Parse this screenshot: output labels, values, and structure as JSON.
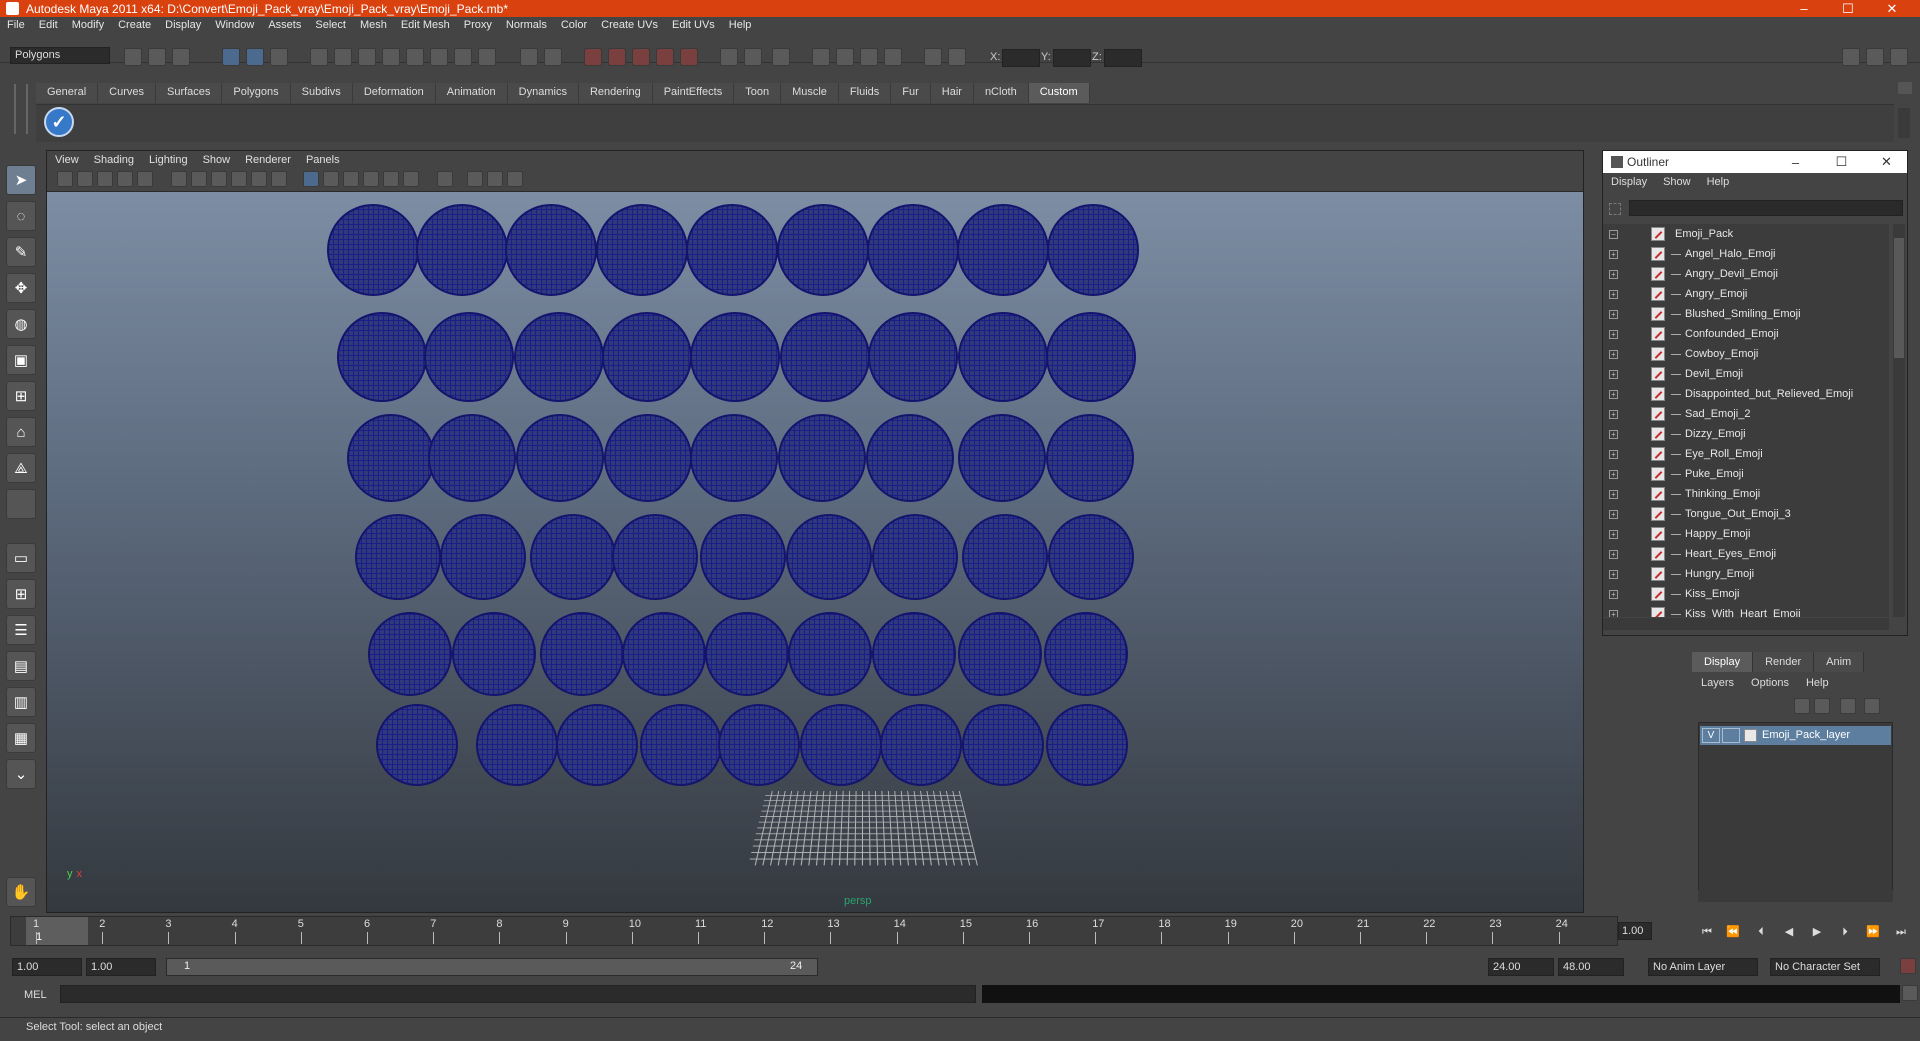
{
  "window": {
    "title": "Autodesk Maya 2011 x64: D:\\Convert\\Emoji_Pack_vray\\Emoji_Pack_vray\\Emoji_Pack.mb*",
    "controls": [
      "–",
      "☐",
      "✕"
    ]
  },
  "menubar": [
    "File",
    "Edit",
    "Modify",
    "Create",
    "Display",
    "Window",
    "Assets",
    "Select",
    "Mesh",
    "Edit Mesh",
    "Proxy",
    "Normals",
    "Color",
    "Create UVs",
    "Edit UVs",
    "Help"
  ],
  "statusline": {
    "mode": "Polygons",
    "x_label": "X:",
    "y_label": "Y:",
    "z_label": "Z:"
  },
  "shelf": {
    "tabs": [
      "General",
      "Curves",
      "Surfaces",
      "Polygons",
      "Subdivs",
      "Deformation",
      "Animation",
      "Dynamics",
      "Rendering",
      "PaintEffects",
      "Toon",
      "Muscle",
      "Fluids",
      "Fur",
      "Hair",
      "nCloth",
      "Custom"
    ],
    "active_tab": "Custom"
  },
  "viewport": {
    "menu": [
      "View",
      "Shading",
      "Lighting",
      "Show",
      "Renderer",
      "Panels"
    ],
    "camera_label": "persp",
    "axis_y": "y",
    "axis_x": "x",
    "wire_color": "#1c1c8a"
  },
  "outliner": {
    "title": "Outliner",
    "menu": [
      "Display",
      "Show",
      "Help"
    ],
    "root": "Emoji_Pack",
    "items": [
      "Angel_Halo_Emoji",
      "Angry_Devil_Emoji",
      "Angry_Emoji",
      "Blushed_Smiling_Emoji",
      "Confounded_Emoji",
      "Cowboy_Emoji",
      "Devil_Emoji",
      "Disappointed_but_Relieved_Emoji",
      "Sad_Emoji_2",
      "Dizzy_Emoji",
      "Eye_Roll_Emoji",
      "Puke_Emoji",
      "Thinking_Emoji",
      "Tongue_Out_Emoji_3",
      "Happy_Emoji",
      "Heart_Eyes_Emoji",
      "Hungry_Emoji",
      "Kiss_Emoji",
      "Kiss_With_Heart_Emoji"
    ]
  },
  "layers": {
    "tabs": [
      "Display",
      "Render",
      "Anim"
    ],
    "active_tab": "Display",
    "menu": [
      "Layers",
      "Options",
      "Help"
    ],
    "layer_visible": "V",
    "layer_name": "Emoji_Pack_layer"
  },
  "timeline": {
    "ticks": [
      "1",
      "2",
      "3",
      "4",
      "5",
      "6",
      "7",
      "8",
      "9",
      "10",
      "11",
      "12",
      "13",
      "14",
      "15",
      "16",
      "17",
      "18",
      "19",
      "20",
      "21",
      "22",
      "23",
      "24"
    ],
    "current_frame": "1.00",
    "playhead_label": "1"
  },
  "range": {
    "start_time": "1.00",
    "playback_start": "1.00",
    "range_start_label": "1",
    "range_end_label": "24",
    "playback_end": "24.00",
    "end_time": "48.00",
    "anim_layer": "No Anim Layer",
    "character_set": "No Character Set"
  },
  "command": {
    "label": "MEL"
  },
  "helpline": {
    "text": "Select Tool: select an object"
  }
}
